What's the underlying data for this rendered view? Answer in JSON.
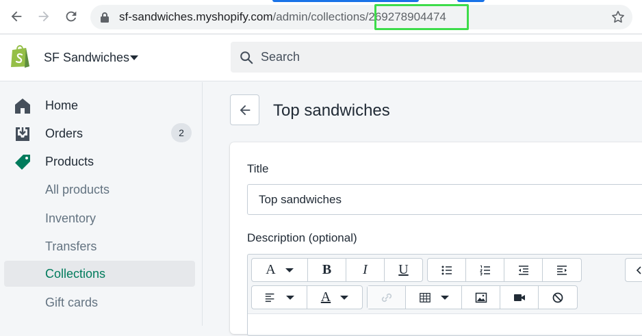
{
  "browser": {
    "url_host": "sf-sandwiches.myshopify.com",
    "url_path": "/admin/collections",
    "url_id": "/269278904474"
  },
  "topbar": {
    "shop_name": "SF Sandwiches",
    "search_placeholder": "Search"
  },
  "sidebar": {
    "items": [
      {
        "label": "Home"
      },
      {
        "label": "Orders",
        "badge": "2"
      },
      {
        "label": "Products"
      },
      {
        "label": "All products"
      },
      {
        "label": "Inventory"
      },
      {
        "label": "Transfers"
      },
      {
        "label": "Collections"
      },
      {
        "label": "Gift cards"
      }
    ]
  },
  "main": {
    "page_title": "Top sandwiches",
    "title_label": "Title",
    "title_value": "Top sandwiches",
    "description_label": "Description (optional)"
  },
  "editor": {
    "font_btn": "A",
    "bold_btn": "B",
    "italic_btn": "I",
    "underline_btn": "U",
    "color_btn": "A"
  },
  "colors": {
    "accent_green": "#007b5c",
    "highlight_green": "#3ddc4a",
    "shopify_green": "#95bf47"
  }
}
